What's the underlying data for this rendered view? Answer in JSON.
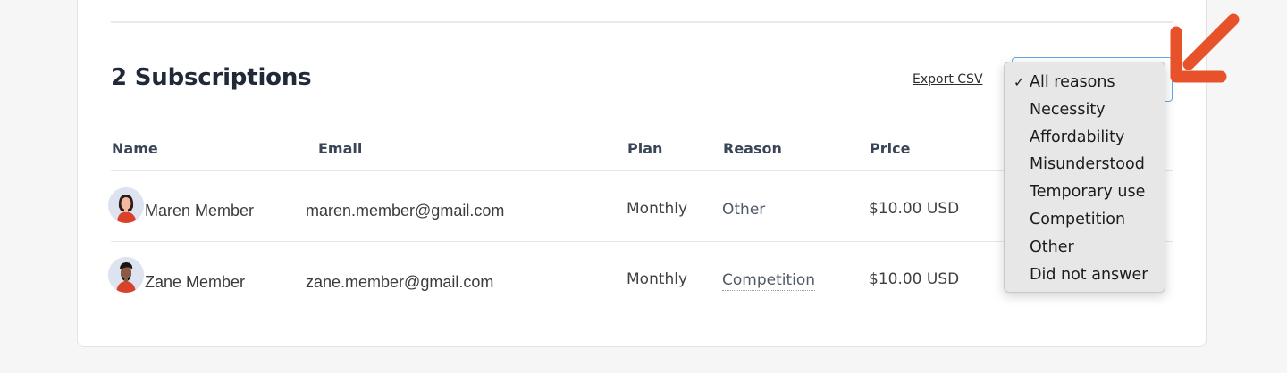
{
  "section": {
    "title": "2 Subscriptions",
    "export_label": "Export CSV"
  },
  "table": {
    "headers": [
      "Name",
      "Email",
      "Plan",
      "Reason",
      "Price"
    ],
    "rows": [
      {
        "name": "Maren Member",
        "email": "maren.member@gmail.com",
        "plan": "Monthly",
        "reason": "Other",
        "price": "$10.00 USD"
      },
      {
        "name": "Zane Member",
        "email": "zane.member@gmail.com",
        "plan": "Monthly",
        "reason": "Competition",
        "price": "$10.00 USD"
      }
    ]
  },
  "reason_filter": {
    "selected": "All reasons",
    "check_glyph": "✓",
    "options": [
      "All reasons",
      "Necessity",
      "Affordability",
      "Misunderstood",
      "Temporary use",
      "Competition",
      "Other",
      "Did not answer"
    ]
  },
  "colors": {
    "annotation_arrow": "#e8522b",
    "focus_border": "#62a8e8",
    "avatar_shirt": "#d9412b"
  },
  "icons": {
    "arrow": "pointer-arrow-icon",
    "avatar_1": "woman-avatar-icon",
    "avatar_2": "man-avatar-icon"
  }
}
